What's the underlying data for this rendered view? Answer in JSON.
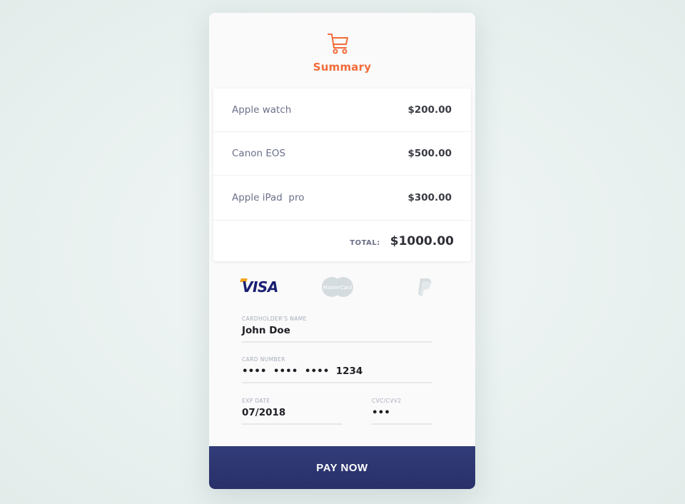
{
  "header": {
    "icon": "shopping-cart-icon",
    "title": "Summary"
  },
  "summary": {
    "items": [
      {
        "name": "Apple watch",
        "price": "$200.00"
      },
      {
        "name": "Canon EOS",
        "price": "$500.00"
      },
      {
        "name": "Apple iPad  pro",
        "price": "$300.00"
      }
    ],
    "total_label": "TOTAL:",
    "total_value": "$1000.00"
  },
  "payment_methods": [
    {
      "name": "VISA",
      "icon": "visa-logo"
    },
    {
      "name": "MasterCard",
      "icon": "mastercard-logo"
    },
    {
      "name": "PayPal",
      "icon": "paypal-logo"
    }
  ],
  "form": {
    "cardholder_label": "CARDHOLDER'S NAME",
    "cardholder_value": "John Doe",
    "card_number_label": "CARD NUMBER",
    "card_number_value": "••••  ••••  ••••  1234",
    "exp_label": "EXP DATE",
    "exp_value": "07/2018",
    "cvc_label": "CVC/CVV2",
    "cvc_value": "•••"
  },
  "pay_button": "PAY NOW",
  "colors": {
    "accent": "#f26b3a",
    "button": "#2d3570",
    "visa": "#1a1f71"
  }
}
